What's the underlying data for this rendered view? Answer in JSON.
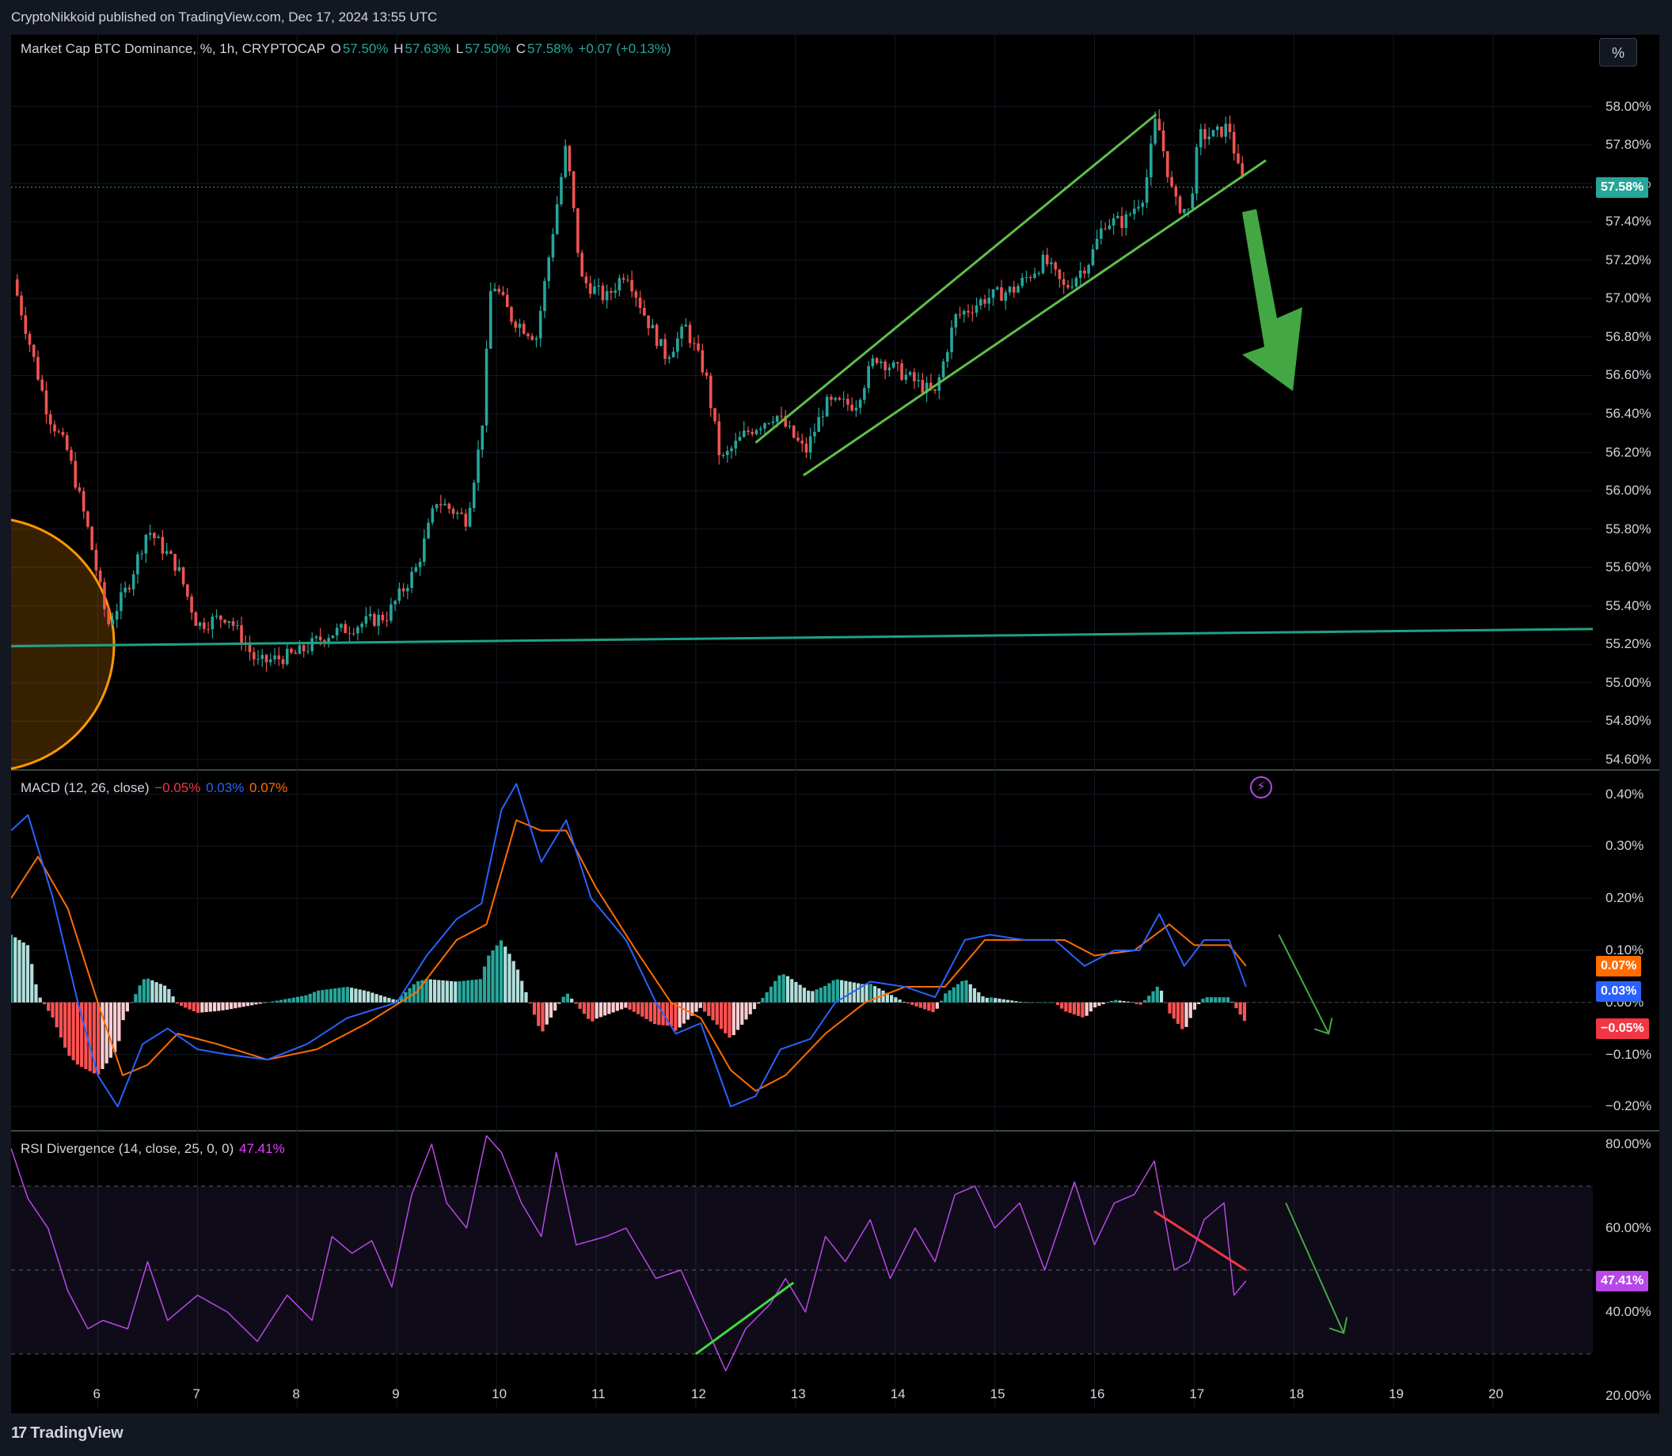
{
  "header": {
    "published_text": "CryptoNikkoid published on TradingView.com, Dec 17, 2024 13:55 UTC"
  },
  "unit_button": "%",
  "legends": {
    "main": {
      "symbol": "Market Cap BTC Dominance, %, 1h, CRYPTOCAP",
      "open_label": "O",
      "open": "57.50%",
      "high_label": "H",
      "high": "57.63%",
      "low_label": "L",
      "low": "57.50%",
      "close_label": "C",
      "close": "57.58%",
      "change": "+0.07 (+0.13%)"
    },
    "macd": {
      "name": "MACD (12, 26, close)",
      "hist": "−0.05%",
      "macd": "0.03%",
      "signal": "0.07%"
    },
    "rsi": {
      "name": "RSI Divergence (14, close, 25, 0, 0)",
      "value": "47.41%"
    }
  },
  "price_tags": {
    "last": "57.58%",
    "macd_signal": "0.07%",
    "macd_line": "0.03%",
    "macd_hist": "−0.05%",
    "rsi": "47.41%"
  },
  "footer": {
    "brand": "TradingView"
  },
  "colors": {
    "up": "#26a69a",
    "down": "#ef5350",
    "macd": "#2962ff",
    "signal": "#ff6d00",
    "rsi": "#b848e8",
    "channel": "#5fbf4a",
    "support": "#1fa187"
  },
  "chart_data": [
    {
      "type": "candlestick",
      "title": "Market Cap BTC Dominance, %, 1h, CRYPTOCAP",
      "x_ticks": [
        "6",
        "7",
        "8",
        "9",
        "10",
        "11",
        "12",
        "13",
        "14",
        "15",
        "16",
        "17",
        "18",
        "19",
        "20"
      ],
      "y_ticks": [
        "58.00%",
        "57.80%",
        "57.60%",
        "57.40%",
        "57.20%",
        "57.00%",
        "56.80%",
        "56.60%",
        "56.40%",
        "56.20%",
        "56.00%",
        "55.80%",
        "55.60%",
        "55.40%",
        "55.20%",
        "55.00%",
        "54.80%",
        "54.60%"
      ],
      "ylim": [
        54.55,
        58.25
      ],
      "x_range_days": [
        5.13,
        21.0
      ],
      "approx_close_path": [
        {
          "x": 5.15,
          "y": 57.1
        },
        {
          "x": 5.3,
          "y": 56.8
        },
        {
          "x": 5.5,
          "y": 56.4
        },
        {
          "x": 5.7,
          "y": 56.2
        },
        {
          "x": 5.9,
          "y": 55.8
        },
        {
          "x": 6.1,
          "y": 55.3
        },
        {
          "x": 6.3,
          "y": 55.5
        },
        {
          "x": 6.5,
          "y": 55.8
        },
        {
          "x": 6.8,
          "y": 55.6
        },
        {
          "x": 7.0,
          "y": 55.3
        },
        {
          "x": 7.3,
          "y": 55.35
        },
        {
          "x": 7.6,
          "y": 55.1
        },
        {
          "x": 8.0,
          "y": 55.15
        },
        {
          "x": 8.3,
          "y": 55.25
        },
        {
          "x": 8.6,
          "y": 55.3
        },
        {
          "x": 8.9,
          "y": 55.35
        },
        {
          "x": 9.2,
          "y": 55.6
        },
        {
          "x": 9.4,
          "y": 55.95
        },
        {
          "x": 9.7,
          "y": 55.85
        },
        {
          "x": 9.85,
          "y": 56.3
        },
        {
          "x": 9.95,
          "y": 57.1
        },
        {
          "x": 10.15,
          "y": 56.9
        },
        {
          "x": 10.4,
          "y": 56.8
        },
        {
          "x": 10.55,
          "y": 57.3
        },
        {
          "x": 10.7,
          "y": 57.8
        },
        {
          "x": 10.85,
          "y": 57.1
        },
        {
          "x": 11.1,
          "y": 57.0
        },
        {
          "x": 11.3,
          "y": 57.15
        },
        {
          "x": 11.5,
          "y": 56.9
        },
        {
          "x": 11.7,
          "y": 56.7
        },
        {
          "x": 11.9,
          "y": 56.85
        },
        {
          "x": 12.1,
          "y": 56.6
        },
        {
          "x": 12.25,
          "y": 56.15
        },
        {
          "x": 12.5,
          "y": 56.3
        },
        {
          "x": 12.8,
          "y": 56.4
        },
        {
          "x": 13.1,
          "y": 56.2
        },
        {
          "x": 13.3,
          "y": 56.45
        },
        {
          "x": 13.6,
          "y": 56.45
        },
        {
          "x": 13.8,
          "y": 56.7
        },
        {
          "x": 14.1,
          "y": 56.6
        },
        {
          "x": 14.4,
          "y": 56.5
        },
        {
          "x": 14.6,
          "y": 56.9
        },
        {
          "x": 14.9,
          "y": 57.0
        },
        {
          "x": 15.2,
          "y": 57.05
        },
        {
          "x": 15.5,
          "y": 57.2
        },
        {
          "x": 15.7,
          "y": 57.05
        },
        {
          "x": 15.95,
          "y": 57.2
        },
        {
          "x": 16.1,
          "y": 57.4
        },
        {
          "x": 16.3,
          "y": 57.4
        },
        {
          "x": 16.5,
          "y": 57.55
        },
        {
          "x": 16.62,
          "y": 57.95
        },
        {
          "x": 16.8,
          "y": 57.5
        },
        {
          "x": 16.95,
          "y": 57.45
        },
        {
          "x": 17.05,
          "y": 57.85
        },
        {
          "x": 17.2,
          "y": 57.85
        },
        {
          "x": 17.35,
          "y": 57.9
        },
        {
          "x": 17.45,
          "y": 57.65
        },
        {
          "x": 17.52,
          "y": 57.58
        }
      ],
      "support_line": [
        {
          "x": 5.13,
          "y": 55.19
        },
        {
          "x": 21.0,
          "y": 55.28
        }
      ],
      "channel_upper": [
        {
          "x": 12.6,
          "y": 56.25
        },
        {
          "x": 16.62,
          "y": 57.96
        }
      ],
      "channel_lower": [
        {
          "x": 13.08,
          "y": 56.08
        },
        {
          "x": 17.72,
          "y": 57.72
        }
      ]
    },
    {
      "type": "macd",
      "title": "MACD (12, 26, close)",
      "y_ticks": [
        "0.40%",
        "0.30%",
        "0.20%",
        "0.10%",
        "0.00%",
        "−0.10%",
        "−0.20%"
      ],
      "ylim": [
        -0.245,
        0.445
      ],
      "macd_line": [
        {
          "x": 5.13,
          "y": 0.33
        },
        {
          "x": 5.3,
          "y": 0.36
        },
        {
          "x": 5.55,
          "y": 0.2
        },
        {
          "x": 5.8,
          "y": 0.0
        },
        {
          "x": 6.0,
          "y": -0.14
        },
        {
          "x": 6.2,
          "y": -0.2
        },
        {
          "x": 6.45,
          "y": -0.08
        },
        {
          "x": 6.7,
          "y": -0.05
        },
        {
          "x": 7.0,
          "y": -0.09
        },
        {
          "x": 7.3,
          "y": -0.1
        },
        {
          "x": 7.7,
          "y": -0.11
        },
        {
          "x": 8.1,
          "y": -0.08
        },
        {
          "x": 8.5,
          "y": -0.03
        },
        {
          "x": 9.0,
          "y": 0.0
        },
        {
          "x": 9.3,
          "y": 0.09
        },
        {
          "x": 9.6,
          "y": 0.16
        },
        {
          "x": 9.85,
          "y": 0.19
        },
        {
          "x": 10.05,
          "y": 0.37
        },
        {
          "x": 10.2,
          "y": 0.42
        },
        {
          "x": 10.45,
          "y": 0.27
        },
        {
          "x": 10.7,
          "y": 0.35
        },
        {
          "x": 10.95,
          "y": 0.2
        },
        {
          "x": 11.3,
          "y": 0.12
        },
        {
          "x": 11.6,
          "y": 0.0
        },
        {
          "x": 11.8,
          "y": -0.06
        },
        {
          "x": 12.05,
          "y": -0.04
        },
        {
          "x": 12.35,
          "y": -0.2
        },
        {
          "x": 12.6,
          "y": -0.18
        },
        {
          "x": 12.85,
          "y": -0.09
        },
        {
          "x": 13.15,
          "y": -0.07
        },
        {
          "x": 13.4,
          "y": 0.0
        },
        {
          "x": 13.75,
          "y": 0.04
        },
        {
          "x": 14.1,
          "y": 0.03
        },
        {
          "x": 14.4,
          "y": 0.01
        },
        {
          "x": 14.7,
          "y": 0.12
        },
        {
          "x": 14.95,
          "y": 0.13
        },
        {
          "x": 15.3,
          "y": 0.12
        },
        {
          "x": 15.6,
          "y": 0.12
        },
        {
          "x": 15.9,
          "y": 0.07
        },
        {
          "x": 16.2,
          "y": 0.1
        },
        {
          "x": 16.45,
          "y": 0.1
        },
        {
          "x": 16.65,
          "y": 0.17
        },
        {
          "x": 16.9,
          "y": 0.07
        },
        {
          "x": 17.1,
          "y": 0.12
        },
        {
          "x": 17.35,
          "y": 0.12
        },
        {
          "x": 17.52,
          "y": 0.03
        }
      ],
      "signal_line": [
        {
          "x": 5.13,
          "y": 0.2
        },
        {
          "x": 5.4,
          "y": 0.28
        },
        {
          "x": 5.7,
          "y": 0.18
        },
        {
          "x": 6.0,
          "y": 0.0
        },
        {
          "x": 6.25,
          "y": -0.14
        },
        {
          "x": 6.5,
          "y": -0.12
        },
        {
          "x": 6.8,
          "y": -0.06
        },
        {
          "x": 7.2,
          "y": -0.08
        },
        {
          "x": 7.7,
          "y": -0.11
        },
        {
          "x": 8.2,
          "y": -0.09
        },
        {
          "x": 8.7,
          "y": -0.04
        },
        {
          "x": 9.2,
          "y": 0.02
        },
        {
          "x": 9.6,
          "y": 0.12
        },
        {
          "x": 9.9,
          "y": 0.15
        },
        {
          "x": 10.2,
          "y": 0.35
        },
        {
          "x": 10.45,
          "y": 0.33
        },
        {
          "x": 10.7,
          "y": 0.33
        },
        {
          "x": 11.0,
          "y": 0.22
        },
        {
          "x": 11.4,
          "y": 0.1
        },
        {
          "x": 11.75,
          "y": 0.0
        },
        {
          "x": 12.05,
          "y": -0.03
        },
        {
          "x": 12.35,
          "y": -0.13
        },
        {
          "x": 12.6,
          "y": -0.17
        },
        {
          "x": 12.9,
          "y": -0.14
        },
        {
          "x": 13.3,
          "y": -0.06
        },
        {
          "x": 13.7,
          "y": 0.0
        },
        {
          "x": 14.1,
          "y": 0.03
        },
        {
          "x": 14.5,
          "y": 0.03
        },
        {
          "x": 14.9,
          "y": 0.12
        },
        {
          "x": 15.3,
          "y": 0.12
        },
        {
          "x": 15.7,
          "y": 0.12
        },
        {
          "x": 16.0,
          "y": 0.09
        },
        {
          "x": 16.4,
          "y": 0.1
        },
        {
          "x": 16.75,
          "y": 0.15
        },
        {
          "x": 17.0,
          "y": 0.11
        },
        {
          "x": 17.35,
          "y": 0.11
        },
        {
          "x": 17.52,
          "y": 0.07
        }
      ]
    },
    {
      "type": "rsi",
      "title": "RSI Divergence (14, close, 25, 0, 0)",
      "y_ticks": [
        "80.00%",
        "60.00%",
        "40.00%",
        "20.00%"
      ],
      "ylim": [
        17.0,
        83.0
      ],
      "bands": [
        70,
        50,
        30
      ],
      "rsi_line": [
        {
          "x": 5.13,
          "y": 79
        },
        {
          "x": 5.3,
          "y": 67
        },
        {
          "x": 5.5,
          "y": 60
        },
        {
          "x": 5.7,
          "y": 45
        },
        {
          "x": 5.9,
          "y": 36
        },
        {
          "x": 6.05,
          "y": 38
        },
        {
          "x": 6.3,
          "y": 36
        },
        {
          "x": 6.5,
          "y": 52
        },
        {
          "x": 6.7,
          "y": 38
        },
        {
          "x": 7.0,
          "y": 44
        },
        {
          "x": 7.3,
          "y": 40
        },
        {
          "x": 7.6,
          "y": 33
        },
        {
          "x": 7.9,
          "y": 44
        },
        {
          "x": 8.15,
          "y": 38
        },
        {
          "x": 8.35,
          "y": 58
        },
        {
          "x": 8.55,
          "y": 54
        },
        {
          "x": 8.75,
          "y": 57
        },
        {
          "x": 8.95,
          "y": 46
        },
        {
          "x": 9.15,
          "y": 68
        },
        {
          "x": 9.35,
          "y": 80
        },
        {
          "x": 9.5,
          "y": 66
        },
        {
          "x": 9.7,
          "y": 60
        },
        {
          "x": 9.9,
          "y": 82
        },
        {
          "x": 10.05,
          "y": 78
        },
        {
          "x": 10.25,
          "y": 66
        },
        {
          "x": 10.45,
          "y": 58
        },
        {
          "x": 10.6,
          "y": 78
        },
        {
          "x": 10.8,
          "y": 56
        },
        {
          "x": 11.1,
          "y": 58
        },
        {
          "x": 11.3,
          "y": 60
        },
        {
          "x": 11.6,
          "y": 48
        },
        {
          "x": 11.85,
          "y": 50
        },
        {
          "x": 12.0,
          "y": 42
        },
        {
          "x": 12.15,
          "y": 34
        },
        {
          "x": 12.3,
          "y": 26
        },
        {
          "x": 12.5,
          "y": 36
        },
        {
          "x": 12.75,
          "y": 42
        },
        {
          "x": 12.9,
          "y": 48
        },
        {
          "x": 13.1,
          "y": 40
        },
        {
          "x": 13.3,
          "y": 58
        },
        {
          "x": 13.5,
          "y": 52
        },
        {
          "x": 13.75,
          "y": 62
        },
        {
          "x": 13.95,
          "y": 48
        },
        {
          "x": 14.2,
          "y": 60
        },
        {
          "x": 14.4,
          "y": 52
        },
        {
          "x": 14.6,
          "y": 68
        },
        {
          "x": 14.8,
          "y": 70
        },
        {
          "x": 15.0,
          "y": 60
        },
        {
          "x": 15.25,
          "y": 66
        },
        {
          "x": 15.5,
          "y": 50
        },
        {
          "x": 15.8,
          "y": 71
        },
        {
          "x": 16.0,
          "y": 56
        },
        {
          "x": 16.2,
          "y": 66
        },
        {
          "x": 16.4,
          "y": 68
        },
        {
          "x": 16.6,
          "y": 76
        },
        {
          "x": 16.8,
          "y": 50
        },
        {
          "x": 16.95,
          "y": 52
        },
        {
          "x": 17.1,
          "y": 62
        },
        {
          "x": 17.3,
          "y": 66
        },
        {
          "x": 17.4,
          "y": 44
        },
        {
          "x": 17.52,
          "y": 47.41
        }
      ],
      "bull_divergence": [
        {
          "x": 12.0,
          "y": 30
        },
        {
          "x": 12.98,
          "y": 47
        }
      ],
      "bear_divergence": [
        {
          "x": 16.6,
          "y": 64
        },
        {
          "x": 17.52,
          "y": 50
        }
      ]
    }
  ]
}
